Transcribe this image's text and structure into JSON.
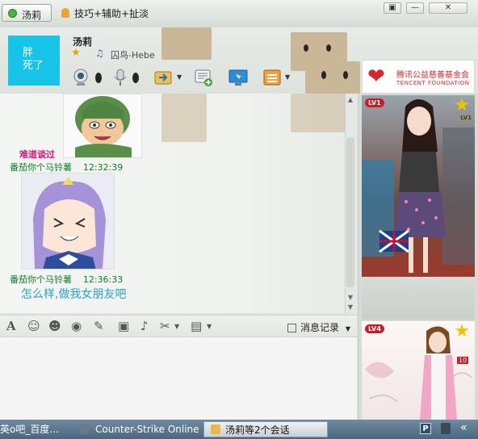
{
  "title_bar": {
    "tabs": [
      {
        "label": "汤莉"
      },
      {
        "label": "技巧+辅助+扯淡"
      }
    ],
    "window_buttons": [
      "▣",
      "—",
      "✕"
    ]
  },
  "contact": {
    "avatar_text": "胖\n死了",
    "name": "汤莉",
    "status_message": "囚鸟-Hebe"
  },
  "charity": {
    "name": "腾讯公益慈善基金会",
    "sub": "TENCENT FOUNDATION"
  },
  "chat": {
    "caption": "难道谈过",
    "messages": [
      {
        "sender": "番茄你个马铃薯",
        "time": "12:32:39"
      },
      {
        "sender": "番茄你个马铃薯",
        "time": "12:36:33",
        "text": "怎么样,做我女朋友吧"
      }
    ]
  },
  "input_toolbar": {
    "history_label": "消息记录"
  },
  "show_panel": {
    "level1": "LV1",
    "level2": "LV4",
    "badge_num": "10",
    "star_lbl": "LV1"
  },
  "taskbar": {
    "items": [
      {
        "label": "英o吧_百度..."
      },
      {
        "label": "Counter-Strike Online"
      },
      {
        "label": "汤莉等2个会话"
      }
    ]
  },
  "colors": {
    "avatar_bg": "#17c3e6",
    "caption": "#e0147a",
    "sender": "#0f7d2a",
    "message_text": "#27a3c7",
    "charity": "#d7262e"
  }
}
